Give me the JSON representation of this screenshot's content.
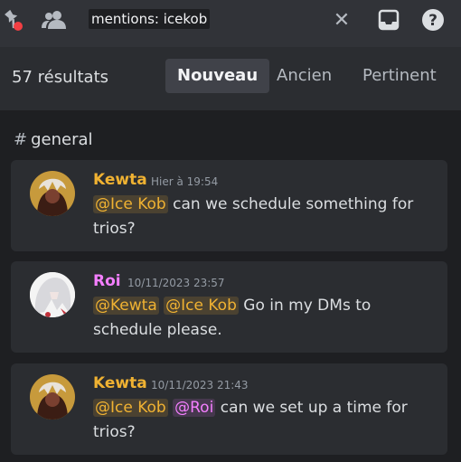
{
  "topbar": {
    "icons": [
      "pin-icon",
      "members-icon",
      "close-icon",
      "inbox-icon",
      "help-icon"
    ],
    "search_query": "mentions: icekob",
    "close_glyph": "✕"
  },
  "results": {
    "count_label": "57 résultats",
    "tabs": [
      {
        "label": "Nouveau",
        "active": true
      },
      {
        "label": "Ancien",
        "active": false
      },
      {
        "label": "Pertinent",
        "active": false
      }
    ]
  },
  "channel": {
    "hash": "#",
    "name": "general"
  },
  "messages": [
    {
      "author": "Kewta",
      "author_color": "#f0b232",
      "timestamp": "Hier à 19:54",
      "mentions": [
        "@Ice Kob"
      ],
      "text": "can we schedule something for trios?"
    },
    {
      "author": "Roi",
      "author_color": "#f47fff",
      "timestamp": "10/11/2023 23:57",
      "mentions": [
        "@Kewta",
        "@Ice Kob"
      ],
      "text": "Go in my DMs to schedule please."
    },
    {
      "author": "Kewta",
      "author_color": "#f0b232",
      "timestamp": "10/11/2023 21:43",
      "mentions": [
        "@Ice Kob",
        "@Roi"
      ],
      "text": "can we set up a time for trios?"
    }
  ],
  "colors": {
    "app_bg": "#2b2d31",
    "list_bg": "#1e1f22",
    "accent_yellow": "#f0b232",
    "accent_pink": "#f47fff"
  }
}
